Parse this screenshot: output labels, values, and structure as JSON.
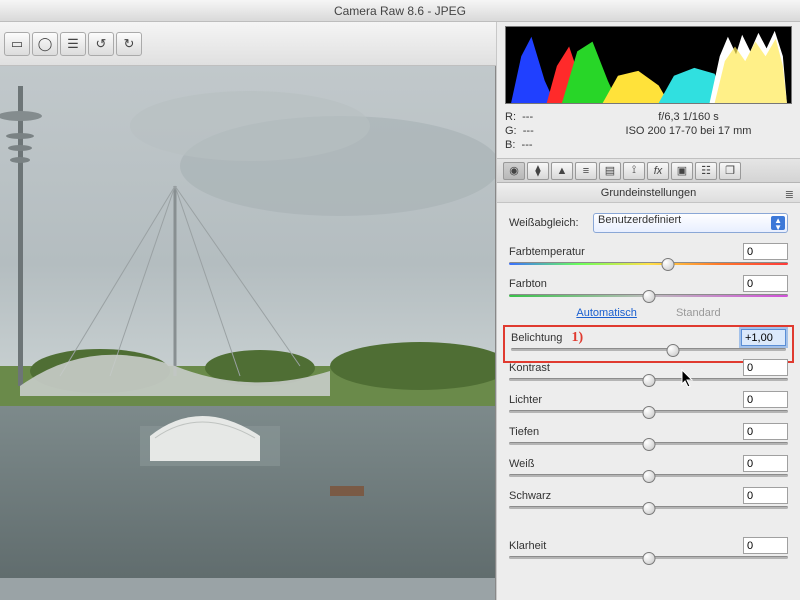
{
  "title": "Camera Raw 8.6 - JPEG",
  "rgb": {
    "r_label": "R:",
    "g_label": "G:",
    "b_label": "B:",
    "none": "---"
  },
  "exif": {
    "line1": "f/6,3   1/160 s",
    "line2": "ISO 200   17-70 bei 17 mm"
  },
  "panel_title": "Grundeinstellungen",
  "wb": {
    "label": "Weißabgleich:",
    "value": "Benutzerdefiniert"
  },
  "links": {
    "auto": "Automatisch",
    "standard": "Standard"
  },
  "sliders": {
    "temp": {
      "label": "Farbtemperatur",
      "value": "0",
      "pos": 57
    },
    "tint": {
      "label": "Farbton",
      "value": "0",
      "pos": 50
    },
    "exposure": {
      "label": "Belichtung",
      "value": "+1,00",
      "pos": 59
    },
    "contrast": {
      "label": "Kontrast",
      "value": "0",
      "pos": 50
    },
    "highlights": {
      "label": "Lichter",
      "value": "0",
      "pos": 50
    },
    "shadows": {
      "label": "Tiefen",
      "value": "0",
      "pos": 50
    },
    "whites": {
      "label": "Weiß",
      "value": "0",
      "pos": 50
    },
    "blacks": {
      "label": "Schwarz",
      "value": "0",
      "pos": 50
    },
    "clarity": {
      "label": "Klarheit",
      "value": "0",
      "pos": 50
    }
  },
  "annotation": "1)",
  "toolbar_icons": [
    "rect",
    "circle",
    "list",
    "rot-left",
    "rot-right"
  ],
  "tab_icons": [
    "aperture",
    "curve",
    "triangle",
    "levels",
    "split",
    "lens",
    "fx",
    "camera",
    "grid",
    "presets"
  ]
}
